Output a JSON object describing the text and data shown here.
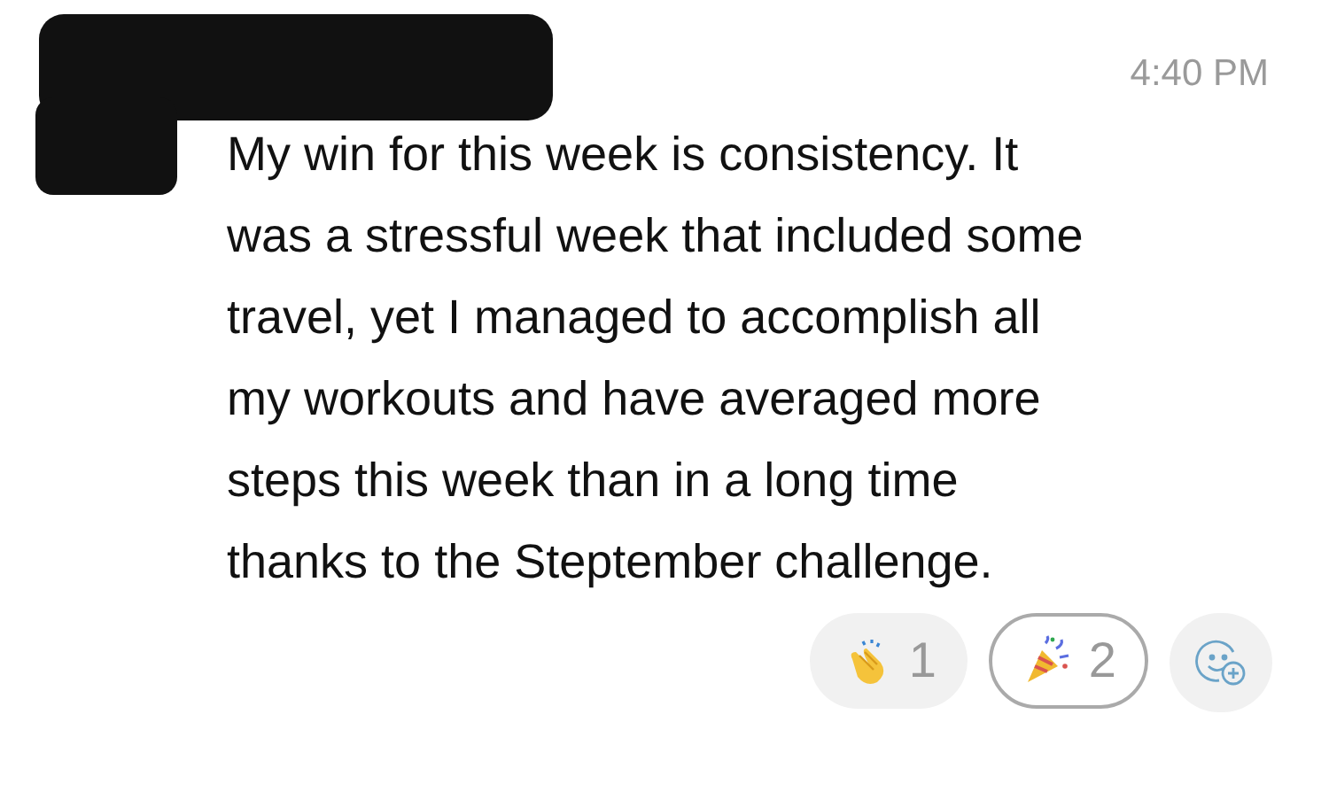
{
  "message": {
    "time": "4:40 PM",
    "body_lines": [
      "My win for this week is consistency. It",
      "was a stressful week that included some",
      "travel, yet I managed to accomplish all",
      "my workouts and have averaged more",
      "steps this week than in a long time",
      "thanks to the Steptember challenge."
    ],
    "reactions": [
      {
        "kind": "clap",
        "count": "1",
        "selected": false
      },
      {
        "kind": "party",
        "count": "2",
        "selected": true
      }
    ]
  }
}
